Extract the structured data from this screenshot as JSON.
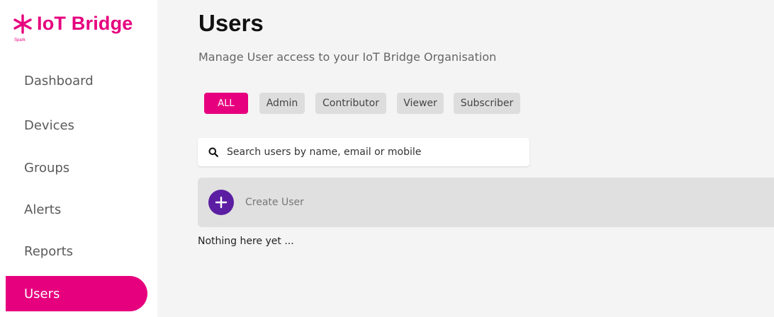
{
  "brand": {
    "name": "IoT Bridge",
    "sub": "Spark",
    "color": "#e6007e"
  },
  "sidebar": {
    "items": [
      {
        "label": "Dashboard"
      },
      {
        "label": "Devices"
      },
      {
        "label": "Groups"
      },
      {
        "label": "Alerts"
      },
      {
        "label": "Reports"
      },
      {
        "label": "Users",
        "active": true
      }
    ]
  },
  "page": {
    "title": "Users",
    "subtitle": "Manage User access to your IoT Bridge Organisation"
  },
  "filters": {
    "items": [
      {
        "label": "ALL",
        "active": true
      },
      {
        "label": "Admin"
      },
      {
        "label": "Contributor"
      },
      {
        "label": "Viewer"
      },
      {
        "label": "Subscriber"
      }
    ]
  },
  "search": {
    "placeholder": "Search users by name, email or mobile",
    "icon": "search-icon"
  },
  "create": {
    "label": "Create User",
    "icon": "plus-icon",
    "color": "#5b1ea3"
  },
  "empty_message": "Nothing here yet ..."
}
